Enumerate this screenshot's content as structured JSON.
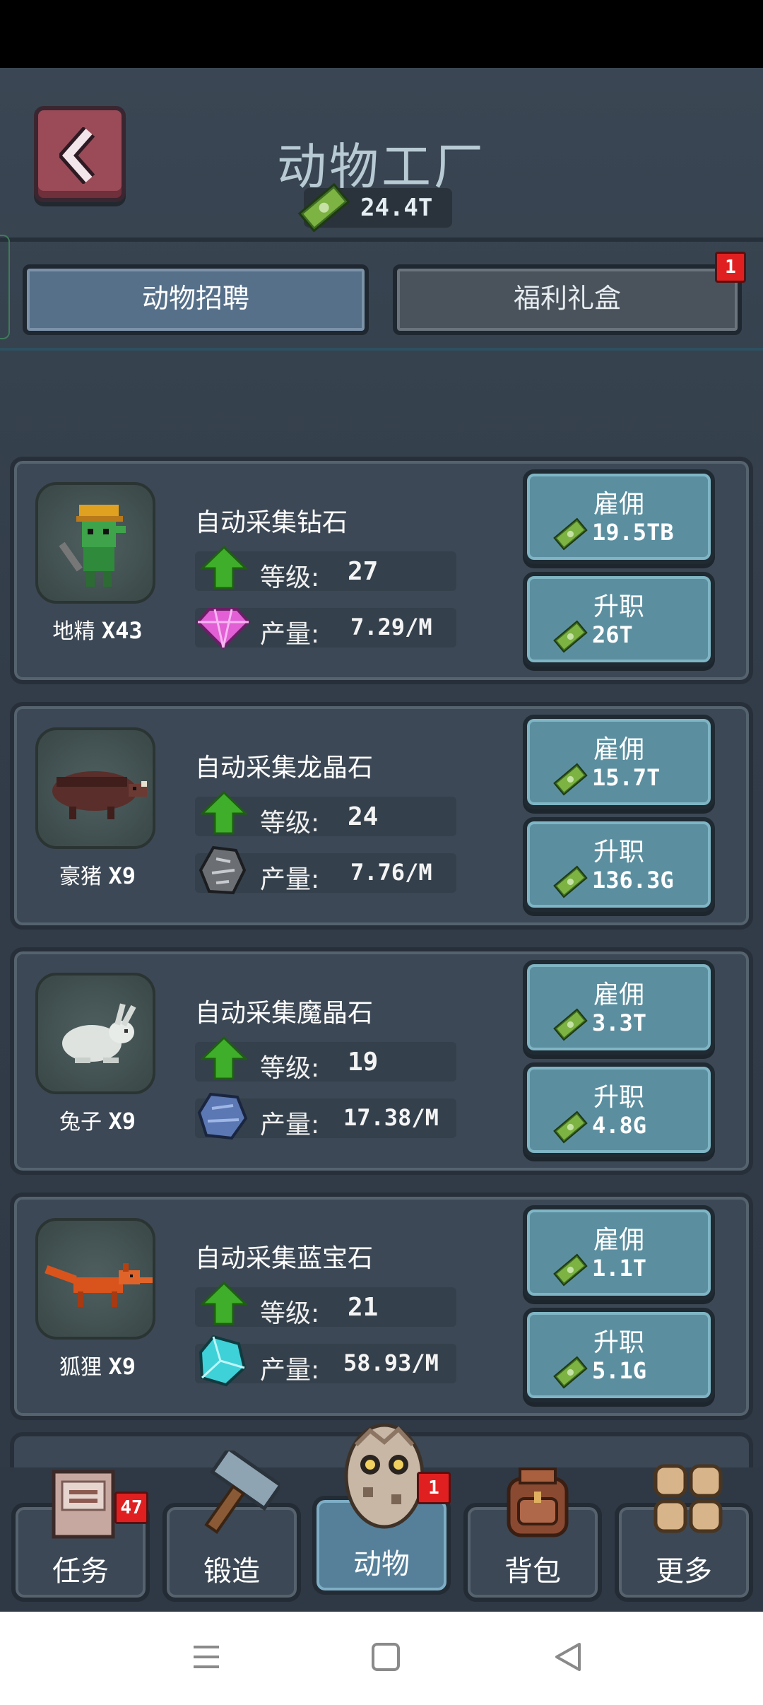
{
  "header": {
    "title": "动物工厂",
    "currency": "24.4T",
    "back_icon": "chevron-left-icon"
  },
  "tabs": [
    {
      "label": "动物招聘",
      "active": true
    },
    {
      "label": "福利礼盒",
      "active": false,
      "badge": "1"
    }
  ],
  "labels": {
    "level": "等级:",
    "output": "产量:",
    "hire": "雇佣",
    "promote": "升职"
  },
  "animals": [
    {
      "name": "地精",
      "count": "X43",
      "task": "自动采集钻石",
      "level": "27",
      "output": "7.29/M",
      "hire_cost": "19.5TB",
      "promote_cost": "26T",
      "resource_icon": "pink-diamond-icon"
    },
    {
      "name": "豪猪",
      "count": "X9",
      "task": "自动采集龙晶石",
      "level": "24",
      "output": "7.76/M",
      "hire_cost": "15.7T",
      "promote_cost": "136.3G",
      "resource_icon": "dragon-crystal-icon"
    },
    {
      "name": "兔子",
      "count": "X9",
      "task": "自动采集魔晶石",
      "level": "19",
      "output": "17.38/M",
      "hire_cost": "3.3T",
      "promote_cost": "4.8G",
      "resource_icon": "magic-crystal-icon"
    },
    {
      "name": "狐狸",
      "count": "X9",
      "task": "自动采集蓝宝石",
      "level": "21",
      "output": "58.93/M",
      "hire_cost": "1.1T",
      "promote_cost": "5.1G",
      "resource_icon": "sapphire-icon"
    }
  ],
  "nav": [
    {
      "label": "任务",
      "icon": "task-book-icon",
      "badge": "47"
    },
    {
      "label": "锻造",
      "icon": "hammer-icon"
    },
    {
      "label": "动物",
      "icon": "owl-egg-icon",
      "badge": "1",
      "active": true
    },
    {
      "label": "背包",
      "icon": "backpack-icon"
    },
    {
      "label": "更多",
      "icon": "grid-more-icon"
    }
  ],
  "system_nav": [
    "menu-icon",
    "home-square-icon",
    "back-triangle-icon"
  ],
  "colors": {
    "background": "#323d49",
    "button_teal": "#5b8fa0",
    "back_button": "#9b4b58",
    "badge_red": "#e02020"
  }
}
